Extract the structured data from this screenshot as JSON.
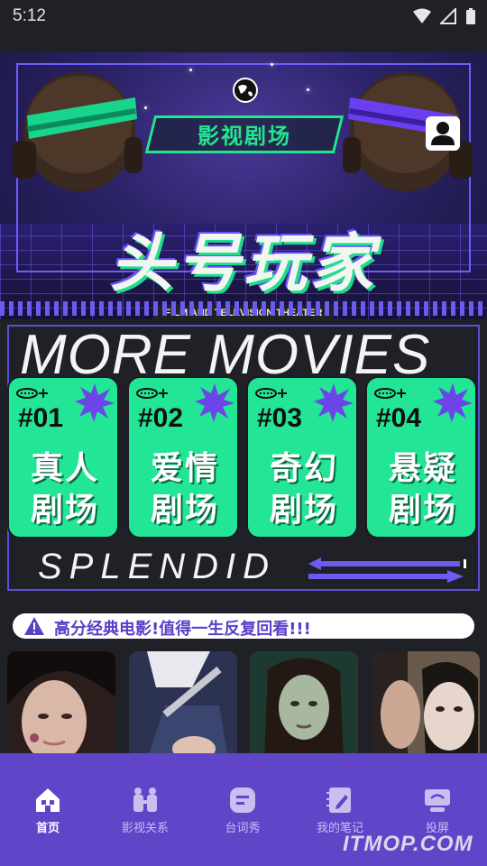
{
  "status_bar": {
    "time": "5:12"
  },
  "banner": {
    "tag": "影视剧场",
    "title": "头号玩家",
    "subtitle": "FILM AND TELEVISION THEATER"
  },
  "movies_panel": {
    "heading": "MORE MOVIES",
    "footer": "SPLENDID",
    "cards": [
      {
        "number": "#01",
        "line1": "真人",
        "line2": "剧场"
      },
      {
        "number": "#02",
        "line1": "爱情",
        "line2": "剧场"
      },
      {
        "number": "#03",
        "line1": "奇幻",
        "line2": "剧场"
      },
      {
        "number": "#04",
        "line1": "悬疑",
        "line2": "剧场"
      }
    ]
  },
  "notice": {
    "text": "高分经典电影!值得一生反复回看!!!"
  },
  "tabs": [
    {
      "label": "首页",
      "icon": "home-icon",
      "active": true
    },
    {
      "label": "影视关系",
      "icon": "people-icon",
      "active": false
    },
    {
      "label": "台词秀",
      "icon": "chat-icon",
      "active": false
    },
    {
      "label": "我的笔记",
      "icon": "notebook-icon",
      "active": false
    },
    {
      "label": "投屏",
      "icon": "cast-icon",
      "active": false
    }
  ],
  "watermark": "ITMOP.COM",
  "colors": {
    "accent_green": "#22e595",
    "accent_purple": "#6145c9",
    "background": "#202127"
  }
}
